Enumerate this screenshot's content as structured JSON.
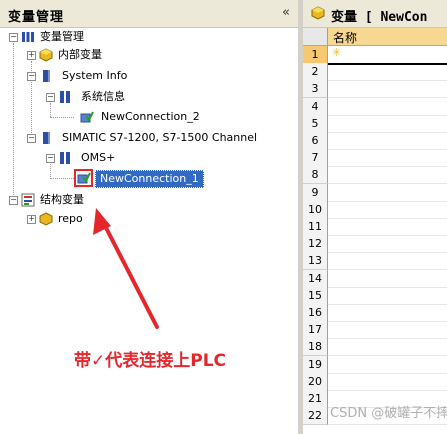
{
  "left_panel": {
    "title": "变量管理",
    "collapse": "«",
    "tree": {
      "root": "变量管理",
      "internal_vars": "内部变量",
      "system_info": "System Info",
      "system_info_child": "系统信息",
      "conn2": "NewConnection_2",
      "simatic": "SIMATIC S7-1200, S7-1500 Channel",
      "oms": "OMS+",
      "conn1": "NewConnection_1",
      "struct_vars": "结构变量",
      "repo": "repo"
    }
  },
  "right_panel": {
    "title": "变量 [ NewCon",
    "column_name": "名称",
    "rows": [
      "1",
      "2",
      "3",
      "4",
      "5",
      "6",
      "7",
      "8",
      "9",
      "10",
      "11",
      "12",
      "13",
      "14",
      "15",
      "16",
      "17",
      "18",
      "19",
      "20",
      "21",
      "22"
    ]
  },
  "annotation": "带✓代表连接上PLC",
  "watermark": "CSDN @破罐子不摔",
  "colors": {
    "accent": "#e5262b",
    "selection": "#316ac5",
    "header_bg": "#f6d892"
  }
}
